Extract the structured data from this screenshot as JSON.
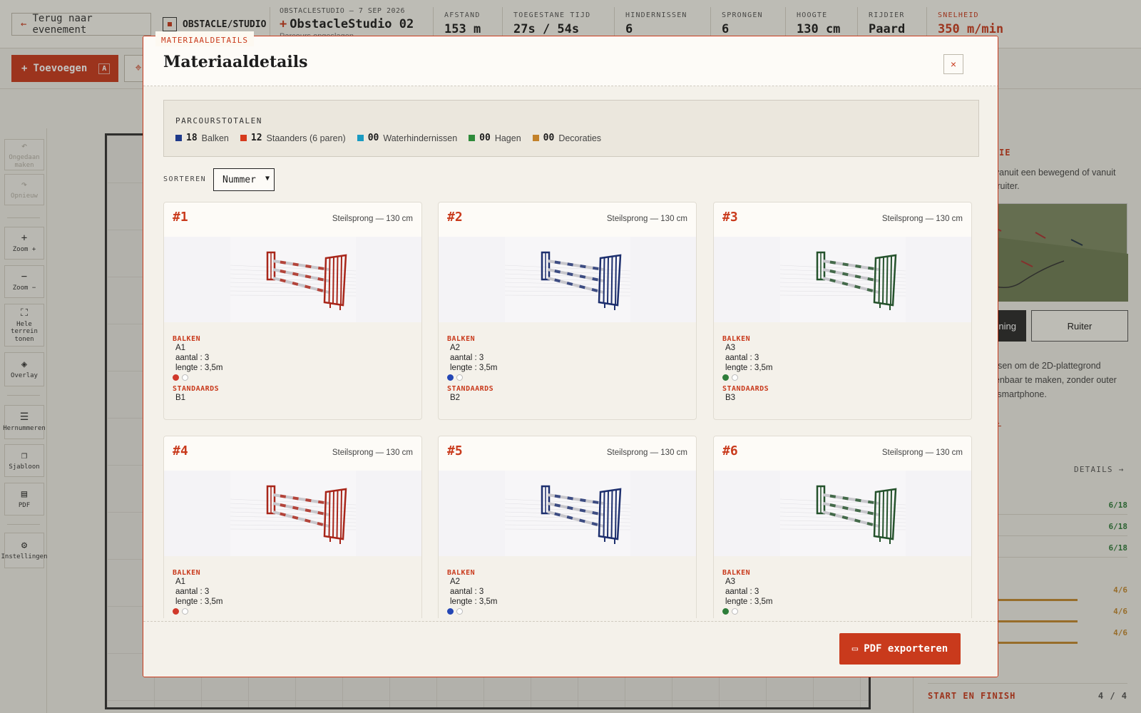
{
  "header": {
    "back_label": "Terug naar evenement",
    "brand": "OBSTACLE/STUDIO",
    "event_eyebrow": "OBSTACLESTUDIO — 7 SEP 2026",
    "parcours_name": "ObstacleStudio 02",
    "parcours_sub": "Parcours opgeslagen",
    "stats": [
      {
        "label": "AFSTAND",
        "value": "153 m"
      },
      {
        "label": "TOEGESTANE TIJD",
        "value": "27s / 54s"
      },
      {
        "label": "HINDERNISSEN",
        "value": "6"
      },
      {
        "label": "SPRONGEN",
        "value": "6"
      },
      {
        "label": "HOOGTE",
        "value": "130 cm"
      },
      {
        "label": "RIJDIER",
        "value": "Paard"
      },
      {
        "label": "SNELHEID",
        "value": "350 m/min"
      }
    ]
  },
  "toolbar": {
    "add_label": "Toevoegen",
    "add_key": "A"
  },
  "leftrail": [
    {
      "label": "Ongedaan maken",
      "icon": "↶"
    },
    {
      "label": "Opnieuw",
      "icon": "↷"
    },
    {
      "label": "Zoom +",
      "icon": "+"
    },
    {
      "label": "Zoom −",
      "icon": "−"
    },
    {
      "label": "Hele terrein tonen",
      "icon": "⛶"
    },
    {
      "label": "Overlay",
      "icon": "◈"
    },
    {
      "label": "Hernummeren",
      "icon": "☰"
    },
    {
      "label": "Sjabloon",
      "icon": "❐"
    },
    {
      "label": "PDF",
      "icon": "▤"
    },
    {
      "label": "Instellingen",
      "icon": "⚙"
    }
  ],
  "rightpanel": {
    "title": "IE",
    "desc": "rs vanuit een bewegend of vanuit de ruiter.",
    "btn_left": "ning",
    "btn_right": "Ruiter",
    "desc2": "oursen om de 2D-plattegrond openbaar te maken, zonder outer en smartphone.",
    "link": "n →",
    "details_link": "DETAILS →",
    "rows": [
      "6/18",
      "6/18",
      "6/18"
    ],
    "bars": [
      "4/6",
      "4/6",
      "4/6"
    ],
    "start_finish_label": "START EN FINISH",
    "start_finish_value": "4 / 4"
  },
  "modal": {
    "tag": "MATERIAALDETAILS",
    "title": "Materiaaldetails",
    "close": "×",
    "totals_title": "PARCOURSTOTALEN",
    "totals": [
      {
        "count": "18",
        "label": "Balken",
        "color": "#1f3a8a"
      },
      {
        "count": "12",
        "label": "Staanders (6 paren)",
        "color": "#d63a1c"
      },
      {
        "count": "00",
        "label": "Waterhindernissen",
        "color": "#1a9bc2"
      },
      {
        "count": "00",
        "label": "Hagen",
        "color": "#2e8b3a"
      },
      {
        "count": "00",
        "label": "Decoraties",
        "color": "#c3822a"
      }
    ],
    "sort_label": "SORTEREN",
    "sort_value": "Nummer",
    "section_balken": "BALKEN",
    "section_standaards": "STANDAARDS",
    "cards": [
      {
        "num": "#1",
        "type": "Steilsprong — 130 cm",
        "balk": "A1",
        "aantal": "aantal : 3",
        "lengte": "lengte : 3,5m",
        "standaard": "B1",
        "color": "#a8261a",
        "dot": "#d0392b"
      },
      {
        "num": "#2",
        "type": "Steilsprong — 130 cm",
        "balk": "A2",
        "aantal": "aantal : 3",
        "lengte": "lengte : 3,5m",
        "standaard": "B2",
        "color": "#1d2f6e",
        "dot": "#2547b5"
      },
      {
        "num": "#3",
        "type": "Steilsprong — 130 cm",
        "balk": "A3",
        "aantal": "aantal : 3",
        "lengte": "lengte : 3,5m",
        "standaard": "B3",
        "color": "#25522c",
        "dot": "#2e7d3a"
      },
      {
        "num": "#4",
        "type": "Steilsprong — 130 cm",
        "balk": "A1",
        "aantal": "aantal : 3",
        "lengte": "lengte : 3,5m",
        "standaard": "",
        "color": "#a8261a",
        "dot": "#d0392b"
      },
      {
        "num": "#5",
        "type": "Steilsprong — 130 cm",
        "balk": "A2",
        "aantal": "aantal : 3",
        "lengte": "lengte : 3,5m",
        "standaard": "",
        "color": "#1d2f6e",
        "dot": "#2547b5"
      },
      {
        "num": "#6",
        "type": "Steilsprong — 130 cm",
        "balk": "A3",
        "aantal": "aantal : 3",
        "lengte": "lengte : 3,5m",
        "standaard": "",
        "color": "#25522c",
        "dot": "#2e7d3a"
      }
    ],
    "pdf_label": "PDF exporteren"
  }
}
